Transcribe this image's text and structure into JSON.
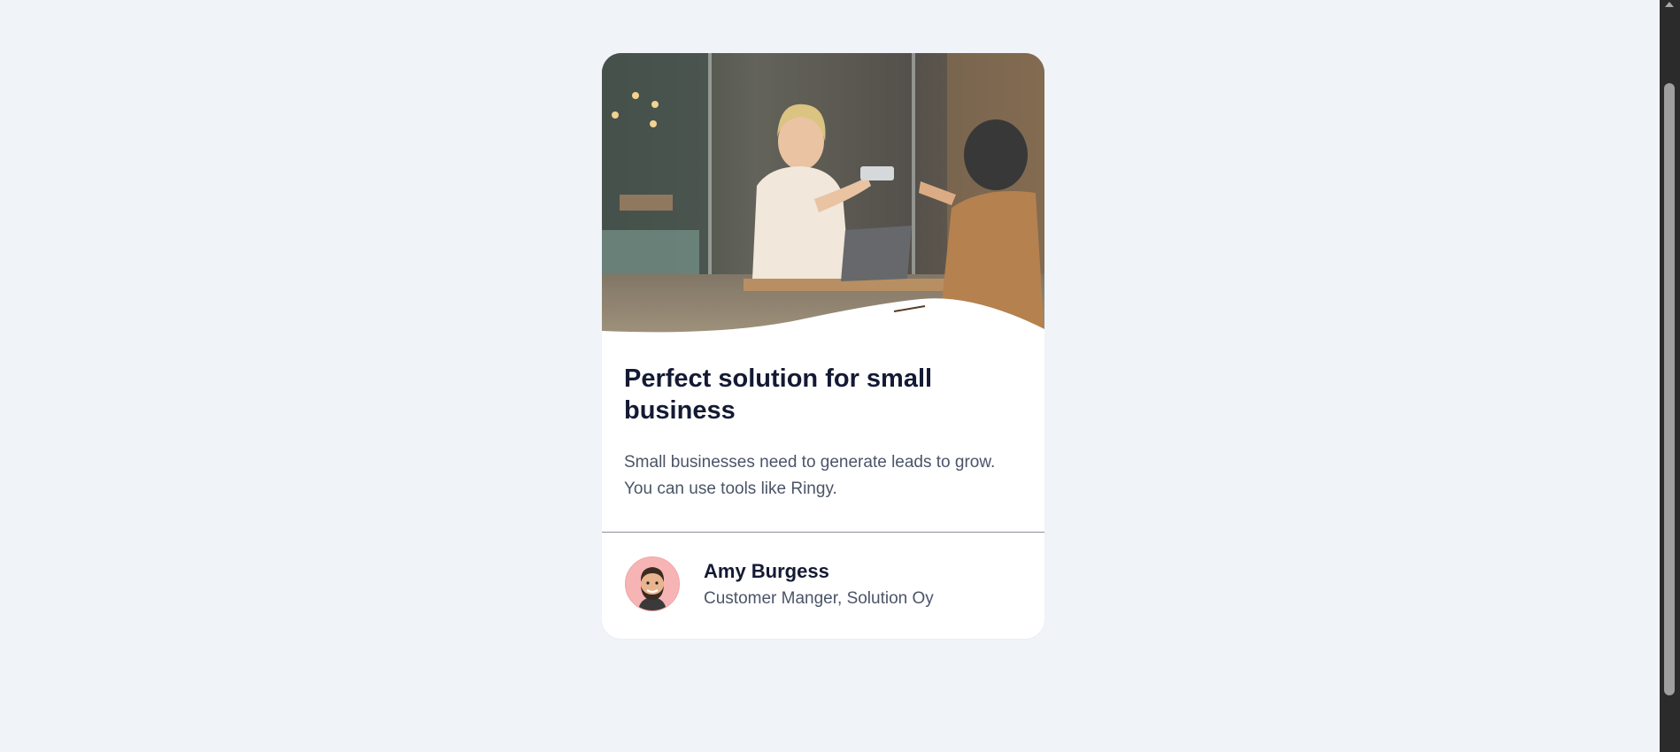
{
  "card": {
    "image_alt": "Woman handing a card across a cafe table",
    "title": "Perfect solution for small business",
    "description": "Small businesses need to generate leads to grow. You can use tools like Ringy."
  },
  "author": {
    "name": "Amy Burgess",
    "role": "Customer Manger, Solution Oy",
    "avatar_icon": "bearded-man-avatar-icon"
  },
  "colors": {
    "page_background": "#f0f4f8",
    "card_background": "#ffffff",
    "title": "#141a33",
    "body_text": "#4b5468",
    "avatar_background": "#f7b4b4"
  }
}
